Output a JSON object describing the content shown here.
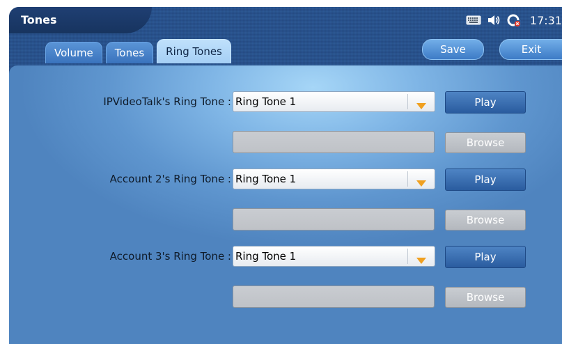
{
  "window": {
    "title": "Tones"
  },
  "status_bar": {
    "icons": [
      "keyboard-icon",
      "speaker-icon",
      "network-alert-icon"
    ],
    "time": "17:31"
  },
  "tabs": [
    {
      "label": "Volume",
      "active": false
    },
    {
      "label": "Tones",
      "active": false
    },
    {
      "label": "Ring Tones",
      "active": true
    }
  ],
  "actions": {
    "save_label": "Save",
    "exit_label": "Exit"
  },
  "ring_tones": [
    {
      "label": "IPVideoTalk's Ring Tone :",
      "selected": "Ring Tone 1",
      "play_label": "Play",
      "file_value": "",
      "browse_label": "Browse"
    },
    {
      "label": "Account 2's Ring Tone :",
      "selected": "Ring Tone 1",
      "play_label": "Play",
      "file_value": "",
      "browse_label": "Browse"
    },
    {
      "label": "Account 3's Ring Tone :",
      "selected": "Ring Tone 1",
      "play_label": "Play",
      "file_value": "",
      "browse_label": "Browse"
    }
  ],
  "colors": {
    "header_bg": "#2a5591",
    "panel_highlight": "#a6d6f7",
    "play_button": "#3a6db0",
    "browse_button_disabled": "#bcc0c5",
    "dropdown_arrow": "#f0a020"
  }
}
